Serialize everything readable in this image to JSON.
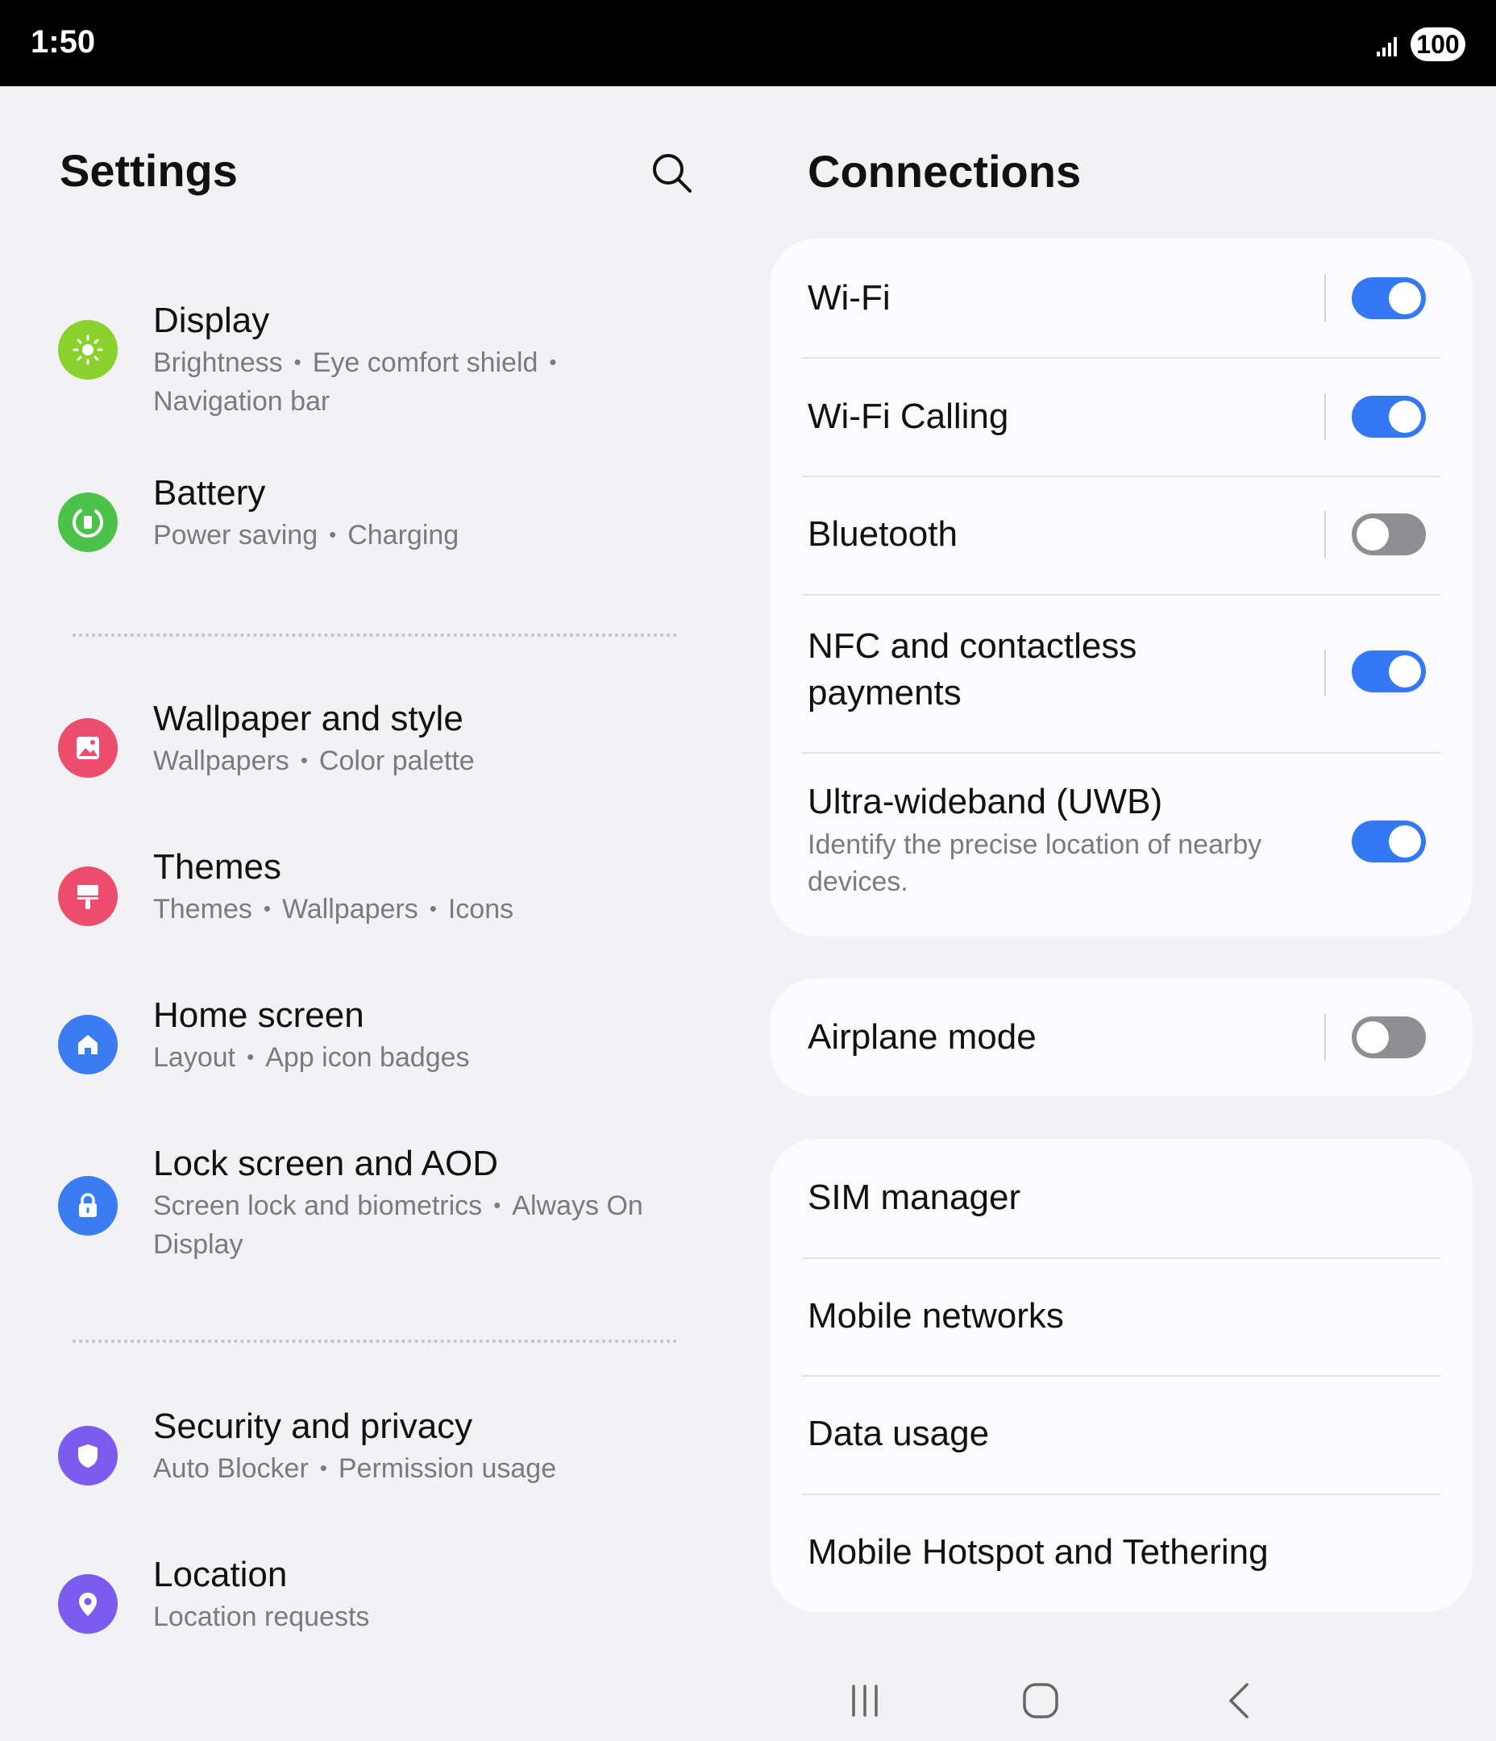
{
  "status_bar": {
    "time": "1:50",
    "battery": "100"
  },
  "left_panel": {
    "title": "Settings",
    "items": [
      {
        "title": "Display",
        "sub1": "Brightness",
        "sub2": "Eye comfort shield",
        "sub3": "Navigation bar",
        "icon": "sun-icon",
        "color": "#8bd12e"
      },
      {
        "title": "Battery",
        "sub1": "Power saving",
        "sub2": "Charging",
        "icon": "battery-icon",
        "color": "#4cc24a"
      },
      {
        "title": "Wallpaper and style",
        "sub1": "Wallpapers",
        "sub2": "Color palette",
        "icon": "image-icon",
        "color": "#ec4d6d"
      },
      {
        "title": "Themes",
        "sub1": "Themes",
        "sub2": "Wallpapers",
        "sub3": "Icons",
        "icon": "paintbrush-icon",
        "color": "#ec4d6d"
      },
      {
        "title": "Home screen",
        "sub1": "Layout",
        "sub2": "App icon badges",
        "icon": "home-icon",
        "color": "#3b7cf2"
      },
      {
        "title": "Lock screen and AOD",
        "sub1": "Screen lock and biometrics",
        "sub2": "Always On",
        "sub3": "Display",
        "icon": "lock-icon",
        "color": "#3b7cf2"
      },
      {
        "title": "Security and privacy",
        "sub1": "Auto Blocker",
        "sub2": "Permission usage",
        "icon": "shield-icon",
        "color": "#7b5cf0"
      },
      {
        "title": "Location",
        "sub1": "Location requests",
        "icon": "location-pin-icon",
        "color": "#7b5cf0"
      }
    ]
  },
  "right_panel": {
    "title": "Connections",
    "card1": [
      {
        "label": "Wi-Fi",
        "toggle": "on"
      },
      {
        "label": "Wi-Fi Calling",
        "toggle": "on"
      },
      {
        "label": "Bluetooth",
        "toggle": "off"
      },
      {
        "label_line1": "NFC and contactless",
        "label_line2": "payments",
        "toggle": "on"
      },
      {
        "label": "Ultra-wideband (UWB)",
        "sub_line1": "Identify the precise location of nearby",
        "sub_line2": "devices.",
        "toggle": "on"
      }
    ],
    "card2": [
      {
        "label": "Airplane mode",
        "toggle": "off"
      }
    ],
    "card3": [
      {
        "label": "SIM manager"
      },
      {
        "label": "Mobile networks"
      },
      {
        "label": "Data usage"
      },
      {
        "label": "Mobile Hotspot and Tethering"
      }
    ]
  },
  "colors": {
    "accent": "#3478f6",
    "toggle_off": "#8e8e93",
    "background": "#f2f2f4",
    "card": "#fbfbfd"
  },
  "nav_bar": {
    "icons": [
      "recents-icon",
      "home-nav-icon",
      "back-icon"
    ]
  }
}
